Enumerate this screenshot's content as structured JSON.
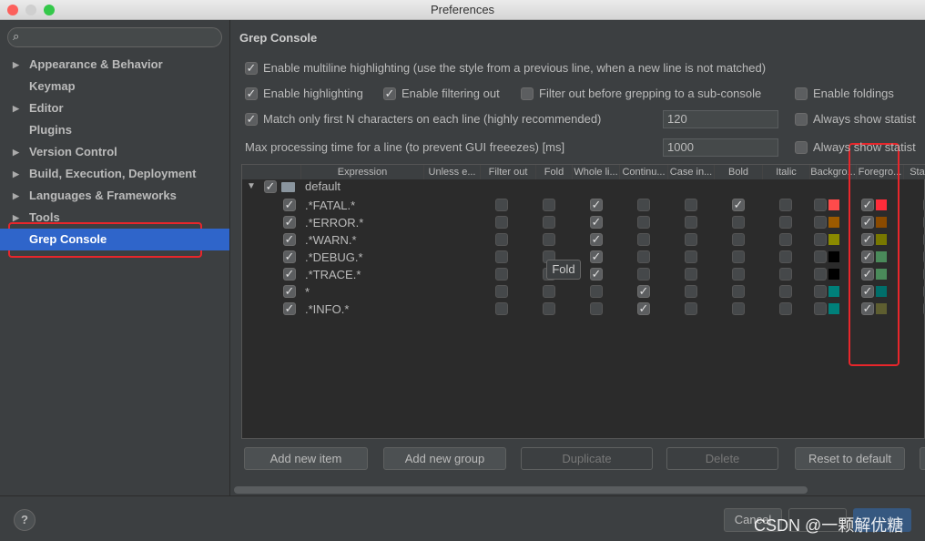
{
  "window": {
    "title": "Preferences"
  },
  "sidebar": {
    "items": [
      {
        "label": "Appearance & Behavior",
        "arrow": true
      },
      {
        "label": "Keymap",
        "arrow": false
      },
      {
        "label": "Editor",
        "arrow": true
      },
      {
        "label": "Plugins",
        "arrow": false
      },
      {
        "label": "Version Control",
        "arrow": true
      },
      {
        "label": "Build, Execution, Deployment",
        "arrow": true
      },
      {
        "label": "Languages & Frameworks",
        "arrow": true
      },
      {
        "label": "Tools",
        "arrow": true
      },
      {
        "label": "Grep Console",
        "arrow": false,
        "selected": true
      }
    ]
  },
  "main": {
    "title": "Grep Console",
    "options": {
      "multiline": {
        "label": "Enable multiline highlighting (use the style from a previous line, when a new line is not matched)",
        "checked": true
      },
      "highlighting": {
        "label": "Enable highlighting",
        "checked": true
      },
      "filtering": {
        "label": "Enable filtering out",
        "checked": true
      },
      "filter_before": {
        "label": "Filter out before grepping to a sub-console",
        "checked": false
      },
      "foldings": {
        "label": "Enable foldings",
        "checked": false
      },
      "match_first": {
        "label": "Match only first N characters on each line (highly recommended)",
        "checked": true,
        "value": "120"
      },
      "always1": {
        "label": "Always show statist",
        "checked": false
      },
      "max_time": {
        "label": "Max processing time for a line (to prevent GUI freeezes) [ms]",
        "value": "1000"
      },
      "always2": {
        "label": "Always show statist",
        "checked": false
      }
    },
    "columns": [
      "Expression",
      "Unless e...",
      "Filter out",
      "Fold",
      "Whole li...",
      "Continu...",
      "Case in...",
      "Bold",
      "Italic",
      "Backgro...",
      "Foregro...",
      "Stat"
    ],
    "group": {
      "label": "default",
      "checked": true
    },
    "rows": [
      {
        "expr": ".*FATAL.*",
        "flags": [
          0,
          0,
          0,
          1,
          0,
          0,
          1,
          0
        ],
        "bg": "#ff4b4b",
        "fg": "#ff2c3a"
      },
      {
        "expr": ".*ERROR.*",
        "flags": [
          0,
          0,
          0,
          1,
          0,
          0,
          0,
          0
        ],
        "bg": "#9c5a00",
        "fg": "#8a4a00"
      },
      {
        "expr": ".*WARN.*",
        "flags": [
          0,
          0,
          0,
          1,
          0,
          0,
          0,
          0
        ],
        "bg": "#8a8a00",
        "fg": "#787800"
      },
      {
        "expr": ".*DEBUG.*",
        "flags": [
          0,
          0,
          0,
          1,
          0,
          0,
          0,
          0
        ],
        "bg": "#000000",
        "fg": "#4a8a5a"
      },
      {
        "expr": ".*TRACE.*",
        "flags": [
          0,
          0,
          0,
          1,
          0,
          0,
          0,
          0
        ],
        "bg": "#000000",
        "fg": "#4a8a5a"
      },
      {
        "expr": "*",
        "flags": [
          0,
          0,
          0,
          0,
          1,
          0,
          0,
          0
        ],
        "bg": "#00807a",
        "fg": "#006e6a"
      },
      {
        "expr": ".*INFO.*",
        "flags": [
          0,
          0,
          0,
          0,
          1,
          0,
          0,
          0
        ],
        "bg": "#00807a",
        "fg": "#5e5e30"
      }
    ],
    "tooltip": "Fold",
    "buttons": [
      {
        "label": "Add new item",
        "enabled": true
      },
      {
        "label": "Add new group",
        "enabled": true
      },
      {
        "label": "Duplicate",
        "enabled": false
      },
      {
        "label": "Delete",
        "enabled": false
      },
      {
        "label": "Reset to default",
        "enabled": true
      }
    ]
  },
  "footer": {
    "cancel": "Cancel",
    "help": "?",
    "watermark": "CSDN @一颗解优糖"
  },
  "colors": {
    "selection": "#2f65ca",
    "highlight_box": "#e8262b"
  }
}
